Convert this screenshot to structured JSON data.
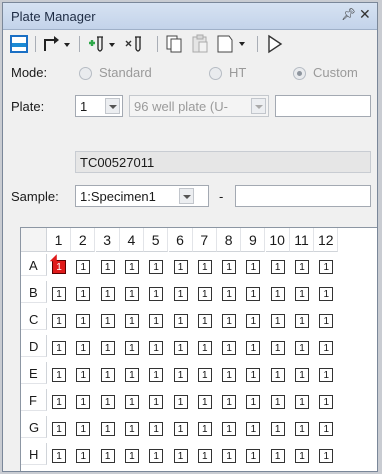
{
  "panel": {
    "title": "Plate Manager",
    "pin_icon": "pin-icon",
    "close_icon": "close-icon"
  },
  "toolbar": {
    "icons": [
      "layout-icon",
      "export-arrow-dropdown-icon",
      "add-tube-dropdown-icon",
      "remove-tube-icon",
      "copy-icon",
      "paste-icon",
      "clipboard-dropdown-icon",
      "run-play-icon"
    ]
  },
  "mode": {
    "label": "Mode:",
    "options": [
      {
        "label": "Standard",
        "selected": false
      },
      {
        "label": "HT",
        "selected": false
      },
      {
        "label": "Custom",
        "selected": true
      }
    ]
  },
  "plate": {
    "label": "Plate:",
    "number": "1",
    "type": "96 well plate (U-",
    "name_value": "",
    "barcode": "TC00527011"
  },
  "sample": {
    "label": "Sample:",
    "value": "1:Specimen1",
    "separator": "-",
    "text_value": ""
  },
  "grid": {
    "columns": [
      "1",
      "2",
      "3",
      "4",
      "5",
      "6",
      "7",
      "8",
      "9",
      "10",
      "11",
      "12"
    ],
    "rows": [
      "A",
      "B",
      "C",
      "D",
      "E",
      "F",
      "G",
      "H"
    ],
    "well_value": "1",
    "selected_well": "A1",
    "colors": {
      "selected": "#e01a1a"
    }
  }
}
